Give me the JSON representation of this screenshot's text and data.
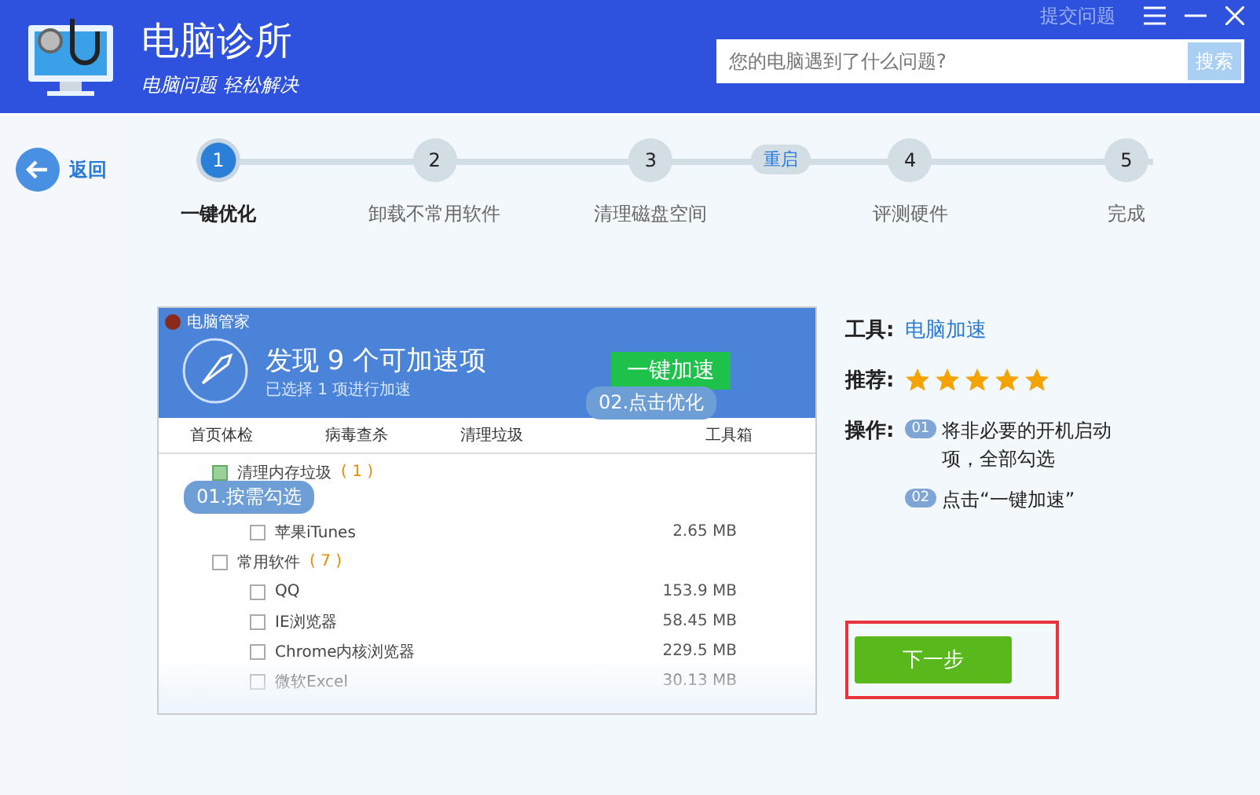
{
  "header": {
    "app_name": "电脑诊所",
    "slogan": "电脑问题 轻松解决",
    "feedback_link": "提交问题",
    "search": {
      "placeholder": "您的电脑遇到了什么问题?",
      "button": "搜索"
    }
  },
  "back_button": "返回",
  "steps": [
    {
      "kind": "step",
      "number": "1",
      "label": "一键优化",
      "selected": true
    },
    {
      "kind": "step",
      "number": "2",
      "label": "卸载不常用软件",
      "selected": false
    },
    {
      "kind": "step",
      "number": "3",
      "label": "清理磁盘空间",
      "selected": false
    },
    {
      "kind": "badge",
      "label": "重启"
    },
    {
      "kind": "step",
      "number": "4",
      "label": "评测硬件",
      "selected": false
    },
    {
      "kind": "step",
      "number": "5",
      "label": "完成",
      "selected": false
    }
  ],
  "preview": {
    "title": "电脑管家",
    "headline": "发现 9 个可加速项",
    "subline": "已选择 1 项进行加速",
    "action": "一键加速",
    "tabs": [
      "首页体检",
      "病毒查杀",
      "清理垃圾",
      "工具箱"
    ],
    "rows": [
      {
        "kind": "group",
        "name": "清理内存垃圾",
        "count": "( 1 )",
        "checked": true
      },
      {
        "kind": "item",
        "name": "苹果iTunes",
        "size": "2.65 MB",
        "checked": false
      },
      {
        "kind": "group",
        "name": "常用软件",
        "count": "( 7 )",
        "checked": false
      },
      {
        "kind": "item",
        "name": "QQ",
        "size": "153.9 MB",
        "checked": false
      },
      {
        "kind": "item",
        "name": "IE浏览器",
        "size": "58.45 MB",
        "checked": false
      },
      {
        "kind": "item",
        "name": "Chrome内核浏览器",
        "size": "229.5 MB",
        "checked": false
      },
      {
        "kind": "item",
        "name": "微软Excel",
        "size": "30.13 MB",
        "checked": false
      }
    ],
    "callouts": [
      "01.按需勾选",
      "02.点击优化"
    ]
  },
  "info": {
    "tool_label": "工具:",
    "tool_link": "电脑加速",
    "rating_label": "推荐:",
    "stars": 5,
    "ops_label": "操作:",
    "ops": [
      {
        "badge": "01",
        "text": "将非必要的开机启动项，全部勾选"
      },
      {
        "badge": "02",
        "text": "点击“一键加速”"
      }
    ]
  },
  "next_button": "下一步"
}
